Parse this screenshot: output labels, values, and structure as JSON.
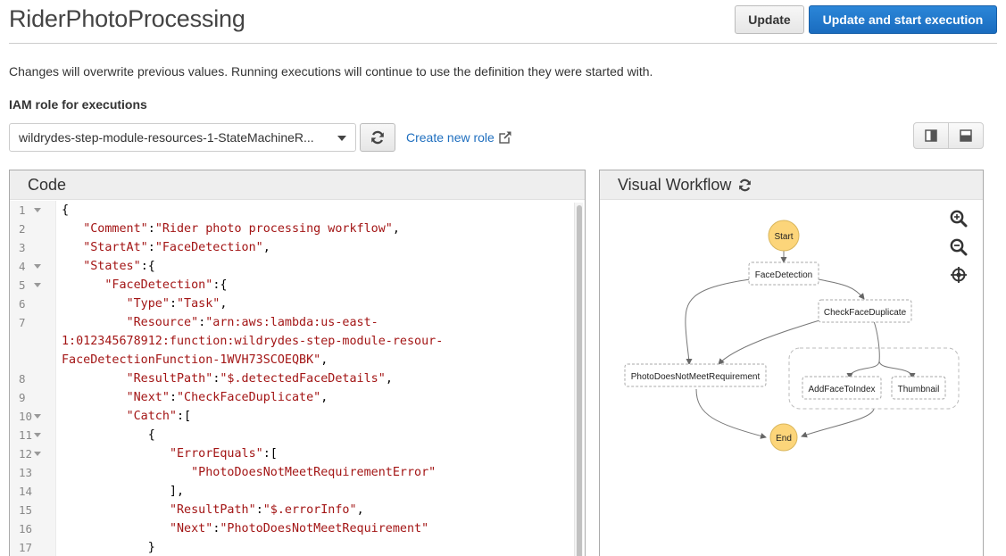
{
  "header": {
    "title": "RiderPhotoProcessing",
    "update_label": "Update",
    "update_start_label": "Update and start execution"
  },
  "notice": "Changes will overwrite previous values. Running executions will continue to use the definition they were started with.",
  "iam": {
    "label": "IAM role for executions",
    "selected_role": "wildrydes-step-module-resources-1-StateMachineR...",
    "create_role_label": "Create new role"
  },
  "colors": {
    "primary": "#1f74c7",
    "link": "#1f6fbf",
    "node_terminal": "#fcd57a",
    "code_string": "#a31515"
  },
  "code_panel": {
    "title": "Code",
    "lines": [
      {
        "num": "1",
        "fold": true,
        "segments": [
          [
            "p",
            "{"
          ]
        ]
      },
      {
        "num": "2",
        "fold": false,
        "segments": [
          [
            "p",
            "   "
          ],
          [
            "s",
            "\"Comment\""
          ],
          [
            "p",
            ":"
          ],
          [
            "s",
            "\"Rider photo processing workflow\""
          ],
          [
            "p",
            ","
          ]
        ]
      },
      {
        "num": "3",
        "fold": false,
        "segments": [
          [
            "p",
            "   "
          ],
          [
            "s",
            "\"StartAt\""
          ],
          [
            "p",
            ":"
          ],
          [
            "s",
            "\"FaceDetection\""
          ],
          [
            "p",
            ","
          ]
        ]
      },
      {
        "num": "4",
        "fold": true,
        "segments": [
          [
            "p",
            "   "
          ],
          [
            "s",
            "\"States\""
          ],
          [
            "p",
            ":{"
          ]
        ]
      },
      {
        "num": "5",
        "fold": true,
        "segments": [
          [
            "p",
            "      "
          ],
          [
            "s",
            "\"FaceDetection\""
          ],
          [
            "p",
            ":{"
          ]
        ]
      },
      {
        "num": "6",
        "fold": false,
        "segments": [
          [
            "p",
            "         "
          ],
          [
            "s",
            "\"Type\""
          ],
          [
            "p",
            ":"
          ],
          [
            "s",
            "\"Task\""
          ],
          [
            "p",
            ","
          ]
        ]
      },
      {
        "num": "7",
        "fold": false,
        "segments": [
          [
            "p",
            "         "
          ],
          [
            "s",
            "\"Resource\""
          ],
          [
            "p",
            ":"
          ],
          [
            "s",
            "\"arn:aws:lambda:us-east-"
          ]
        ]
      },
      {
        "num": "",
        "fold": false,
        "segments": [
          [
            "s",
            "1:012345678912:function:wildrydes-step-module-resour-"
          ]
        ]
      },
      {
        "num": "",
        "fold": false,
        "segments": [
          [
            "s",
            "FaceDetectionFunction-1WVH73SCOEQBK\""
          ],
          [
            "p",
            ","
          ]
        ]
      },
      {
        "num": "8",
        "fold": false,
        "segments": [
          [
            "p",
            "         "
          ],
          [
            "s",
            "\"ResultPath\""
          ],
          [
            "p",
            ":"
          ],
          [
            "s",
            "\"$.detectedFaceDetails\""
          ],
          [
            "p",
            ","
          ]
        ]
      },
      {
        "num": "9",
        "fold": false,
        "segments": [
          [
            "p",
            "         "
          ],
          [
            "s",
            "\"Next\""
          ],
          [
            "p",
            ":"
          ],
          [
            "s",
            "\"CheckFaceDuplicate\""
          ],
          [
            "p",
            ","
          ]
        ]
      },
      {
        "num": "10",
        "fold": true,
        "segments": [
          [
            "p",
            "         "
          ],
          [
            "s",
            "\"Catch\""
          ],
          [
            "p",
            ":["
          ]
        ]
      },
      {
        "num": "11",
        "fold": true,
        "segments": [
          [
            "p",
            "            {"
          ]
        ]
      },
      {
        "num": "12",
        "fold": true,
        "segments": [
          [
            "p",
            "               "
          ],
          [
            "s",
            "\"ErrorEquals\""
          ],
          [
            "p",
            ":["
          ]
        ]
      },
      {
        "num": "13",
        "fold": false,
        "segments": [
          [
            "p",
            "                  "
          ],
          [
            "s",
            "\"PhotoDoesNotMeetRequirementError\""
          ]
        ]
      },
      {
        "num": "14",
        "fold": false,
        "segments": [
          [
            "p",
            "               ],"
          ]
        ]
      },
      {
        "num": "15",
        "fold": false,
        "segments": [
          [
            "p",
            "               "
          ],
          [
            "s",
            "\"ResultPath\""
          ],
          [
            "p",
            ":"
          ],
          [
            "s",
            "\"$.errorInfo\""
          ],
          [
            "p",
            ","
          ]
        ]
      },
      {
        "num": "16",
        "fold": false,
        "segments": [
          [
            "p",
            "               "
          ],
          [
            "s",
            "\"Next\""
          ],
          [
            "p",
            ":"
          ],
          [
            "s",
            "\"PhotoDoesNotMeetRequirement\""
          ]
        ]
      },
      {
        "num": "17",
        "fold": false,
        "segments": [
          [
            "p",
            "            }"
          ]
        ]
      }
    ]
  },
  "workflow_panel": {
    "title": "Visual Workflow",
    "nodes": {
      "start": "Start",
      "face_detection": "FaceDetection",
      "check_face_duplicate": "CheckFaceDuplicate",
      "photo_not_meet": "PhotoDoesNotMeetRequirement",
      "add_face_to_index": "AddFaceToIndex",
      "thumbnail": "Thumbnail",
      "end": "End"
    }
  }
}
